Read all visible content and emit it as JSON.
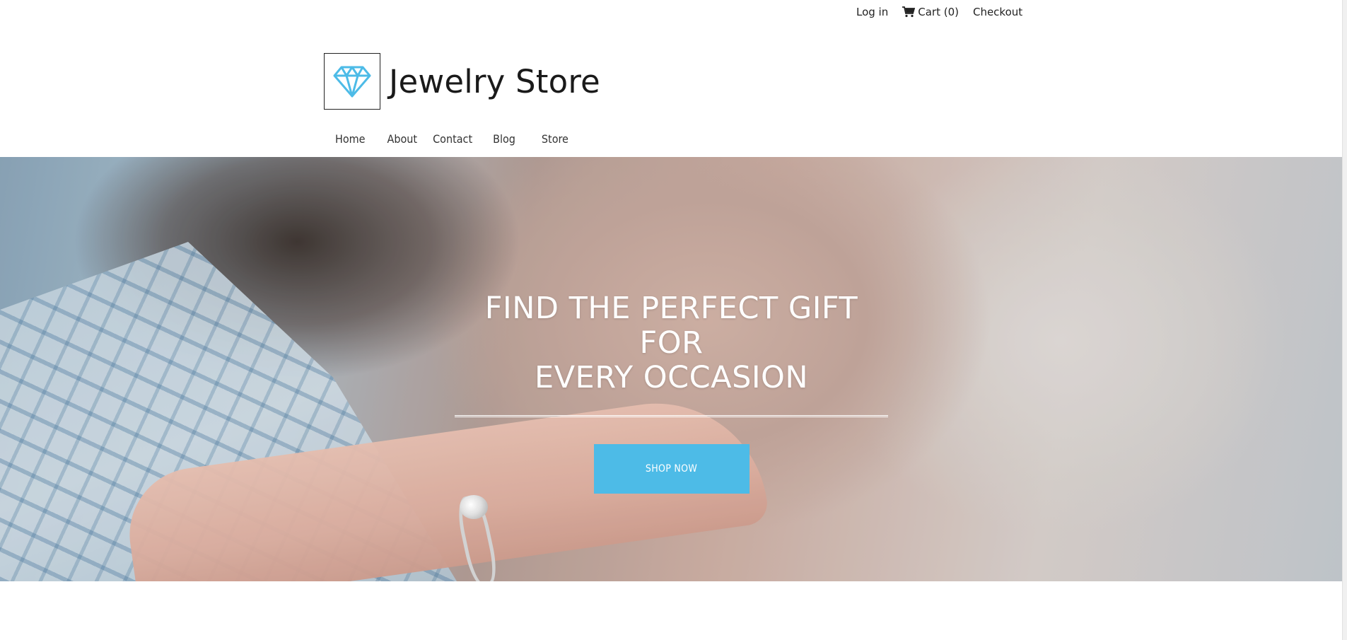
{
  "topbar": {
    "login_label": "Log in",
    "cart_label": "Cart (0)",
    "checkout_label": "Checkout"
  },
  "logo": {
    "text": "Jewelry Store",
    "icon": "diamond-icon",
    "icon_color": "#4dbbe7"
  },
  "nav": {
    "items": [
      {
        "label": "Home"
      },
      {
        "label": "About"
      },
      {
        "label": "Contact"
      },
      {
        "label": "Blog"
      },
      {
        "label": "Store"
      }
    ]
  },
  "hero": {
    "title_line1": "FIND THE PERFECT GIFT FOR",
    "title_line2": "EVERY OCCASION",
    "button_label": "SHOP NOW",
    "button_color": "#4dbbe7"
  }
}
